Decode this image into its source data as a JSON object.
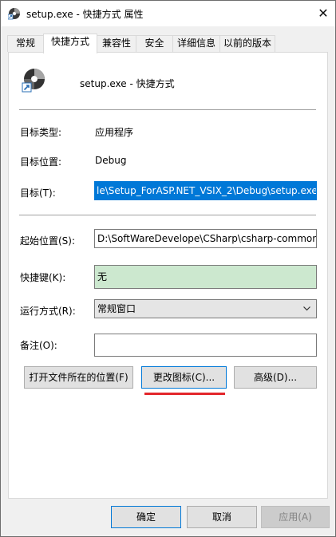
{
  "window": {
    "title": "setup.exe - 快捷方式 属性",
    "close_glyph": "✕"
  },
  "tabs": [
    {
      "label": "常规",
      "active": false
    },
    {
      "label": "快捷方式",
      "active": true
    },
    {
      "label": "兼容性",
      "active": false
    },
    {
      "label": "安全",
      "active": false
    },
    {
      "label": "详细信息",
      "active": false
    },
    {
      "label": "以前的版本",
      "active": false
    }
  ],
  "header": {
    "app_name": "setup.exe - 快捷方式"
  },
  "props": {
    "target_type_label": "目标类型:",
    "target_type_value": "应用程序",
    "target_location_label": "目标位置:",
    "target_location_value": "Debug",
    "target_label": "目标(T):",
    "target_value": "le\\Setup_ForASP.NET_VSIX_2\\Debug\\setup.exe",
    "start_in_label": "起始位置(S):",
    "start_in_value": "D:\\SoftWareDevelope\\CSharp\\csharp-common",
    "hotkey_label": "快捷键(K):",
    "hotkey_value": "无",
    "run_label": "运行方式(R):",
    "run_value": "常规窗口",
    "comment_label": "备注(O):",
    "comment_value": ""
  },
  "buttons": {
    "open_location": "打开文件所在的位置(F)",
    "change_icon": "更改图标(C)...",
    "advanced": "高级(D)...",
    "ok": "确定",
    "cancel": "取消",
    "apply": "应用(A)"
  },
  "colors": {
    "selection": "#0078d7",
    "hotkey_bg": "#cce8cf",
    "annotation": "#e3262b"
  }
}
